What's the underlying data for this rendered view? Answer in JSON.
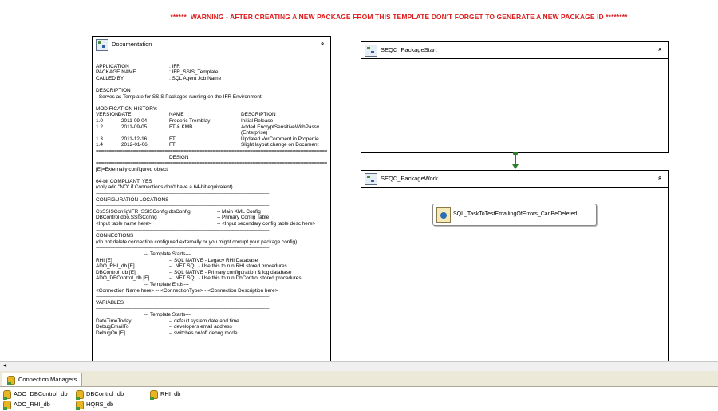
{
  "warning": "******  WARNING - AFTER CREATING A NEW PACKAGE FROM THIS TEMPLATE DON'T FORGET TO GENERATE A NEW PACKAGE ID ********",
  "documentation": {
    "title": "Documentation",
    "collapse_glyph": "«",
    "header_info": [
      {
        "key": "APPLICATION",
        "value": ": IFR"
      },
      {
        "key": "PACKAGE NAME",
        "value": ": IFR_SSIS_Template"
      },
      {
        "key": "CALLED BY",
        "value": ": SQL Agent Job Name"
      }
    ],
    "description_title": "DESCRIPTION",
    "description_text": "- Serves as Template for SSIS Packages running on the IFR Environment",
    "modification_title": "MODIFICATION HISTORY:",
    "history_columns": {
      "version": "VERSION",
      "date": "DATE",
      "name": "NAME",
      "description": "DESCRIPTION"
    },
    "history_rows": [
      {
        "version": "1.0",
        "date": "2011-09-04",
        "name": "Frederic Tremblay",
        "description": "Initial Release"
      },
      {
        "version": "1.2",
        "date": "2011-09-05",
        "name": "FT & KMB",
        "description": "Added EncryptSensitiveWithPassv"
      },
      {
        "version": "",
        "date": "",
        "name": "",
        "description": "(Enterprise)"
      },
      {
        "version": "1.3",
        "date": "2011-12-16",
        "name": "FT",
        "description": "Updated VerComment in Propertie"
      },
      {
        "version": "1.4",
        "date": "2012-01-06",
        "name": "FT",
        "description": "Slight layout change on Document"
      }
    ],
    "design_title": "DESIGN",
    "ext_configured": "[E]=Externally configured object",
    "compliant_line": "64-bit COMPLIANT: YES",
    "compliant_note": "(only add \"NO\" if Connections don't have a 64-bit equivalent)",
    "config_title": "CONFIGURATION LOCATIONS",
    "config_rows": [
      {
        "path": "C:\\SSISConfig\\IFR_SSISConfig.dtsConfig",
        "desc": "-- Main XML Config"
      },
      {
        "path": "DBControl.dbo.SSISConfig",
        "desc": "-- Primary Config Table"
      },
      {
        "path": "<Input table name here>",
        "desc": "-- <Input secondary config table desc here>"
      }
    ],
    "connections_title": "CONNECTIONS",
    "connections_note": "(do not delete connection configured externally or you might corrupt your package config)",
    "template_starts": "--- Template Starts---",
    "connection_rows": [
      {
        "name": "RHI  [E]",
        "desc": "-- SQL NATIVE - Legacy RHI Database"
      },
      {
        "name": "ADO_RHI_db  [E]",
        "desc": "-- .NET SQL - Use this to run RHI stored procedures"
      },
      {
        "name": "DBControl_db  [E]",
        "desc": "-- SQL NATIVE - Primary configuration & log database"
      },
      {
        "name": "ADO_DBControl_db  [E]",
        "desc": "-- .NET SQL - Use this to run DbControl stored procedures"
      }
    ],
    "template_ends": "--- Template Ends---",
    "connection_placeholder": "<Connection Name here>   -- <ConnectionType> -  <Connection Description here>",
    "variables_title": "VARIABLES",
    "variables_template_starts": "--- Template Starts---",
    "variable_rows": [
      {
        "name": "DateTimeToday",
        "desc": "-- default system date and time"
      },
      {
        "name": "DebugEmailTo",
        "desc": "-- developers email address"
      },
      {
        "name": "DebugOn [E]",
        "desc": "-- switches on/off debug mode"
      }
    ]
  },
  "seqc_start": {
    "title": "SEQC_PackageStart",
    "collapse_glyph": "«"
  },
  "seqc_work": {
    "title": "SEQC_PackageWork",
    "collapse_glyph": "«"
  },
  "task": {
    "label": "SQL_TaskToTestEmailingOfErrors_CanBeDeleted"
  },
  "scroll_left_glyph": "◄",
  "connection_managers": {
    "tab_label": "Connection Managers",
    "items": [
      "ADO_DBControl_db",
      "DBControl_db",
      "RHI_db",
      "ADO_RHI_db",
      "HQRS_db"
    ]
  }
}
